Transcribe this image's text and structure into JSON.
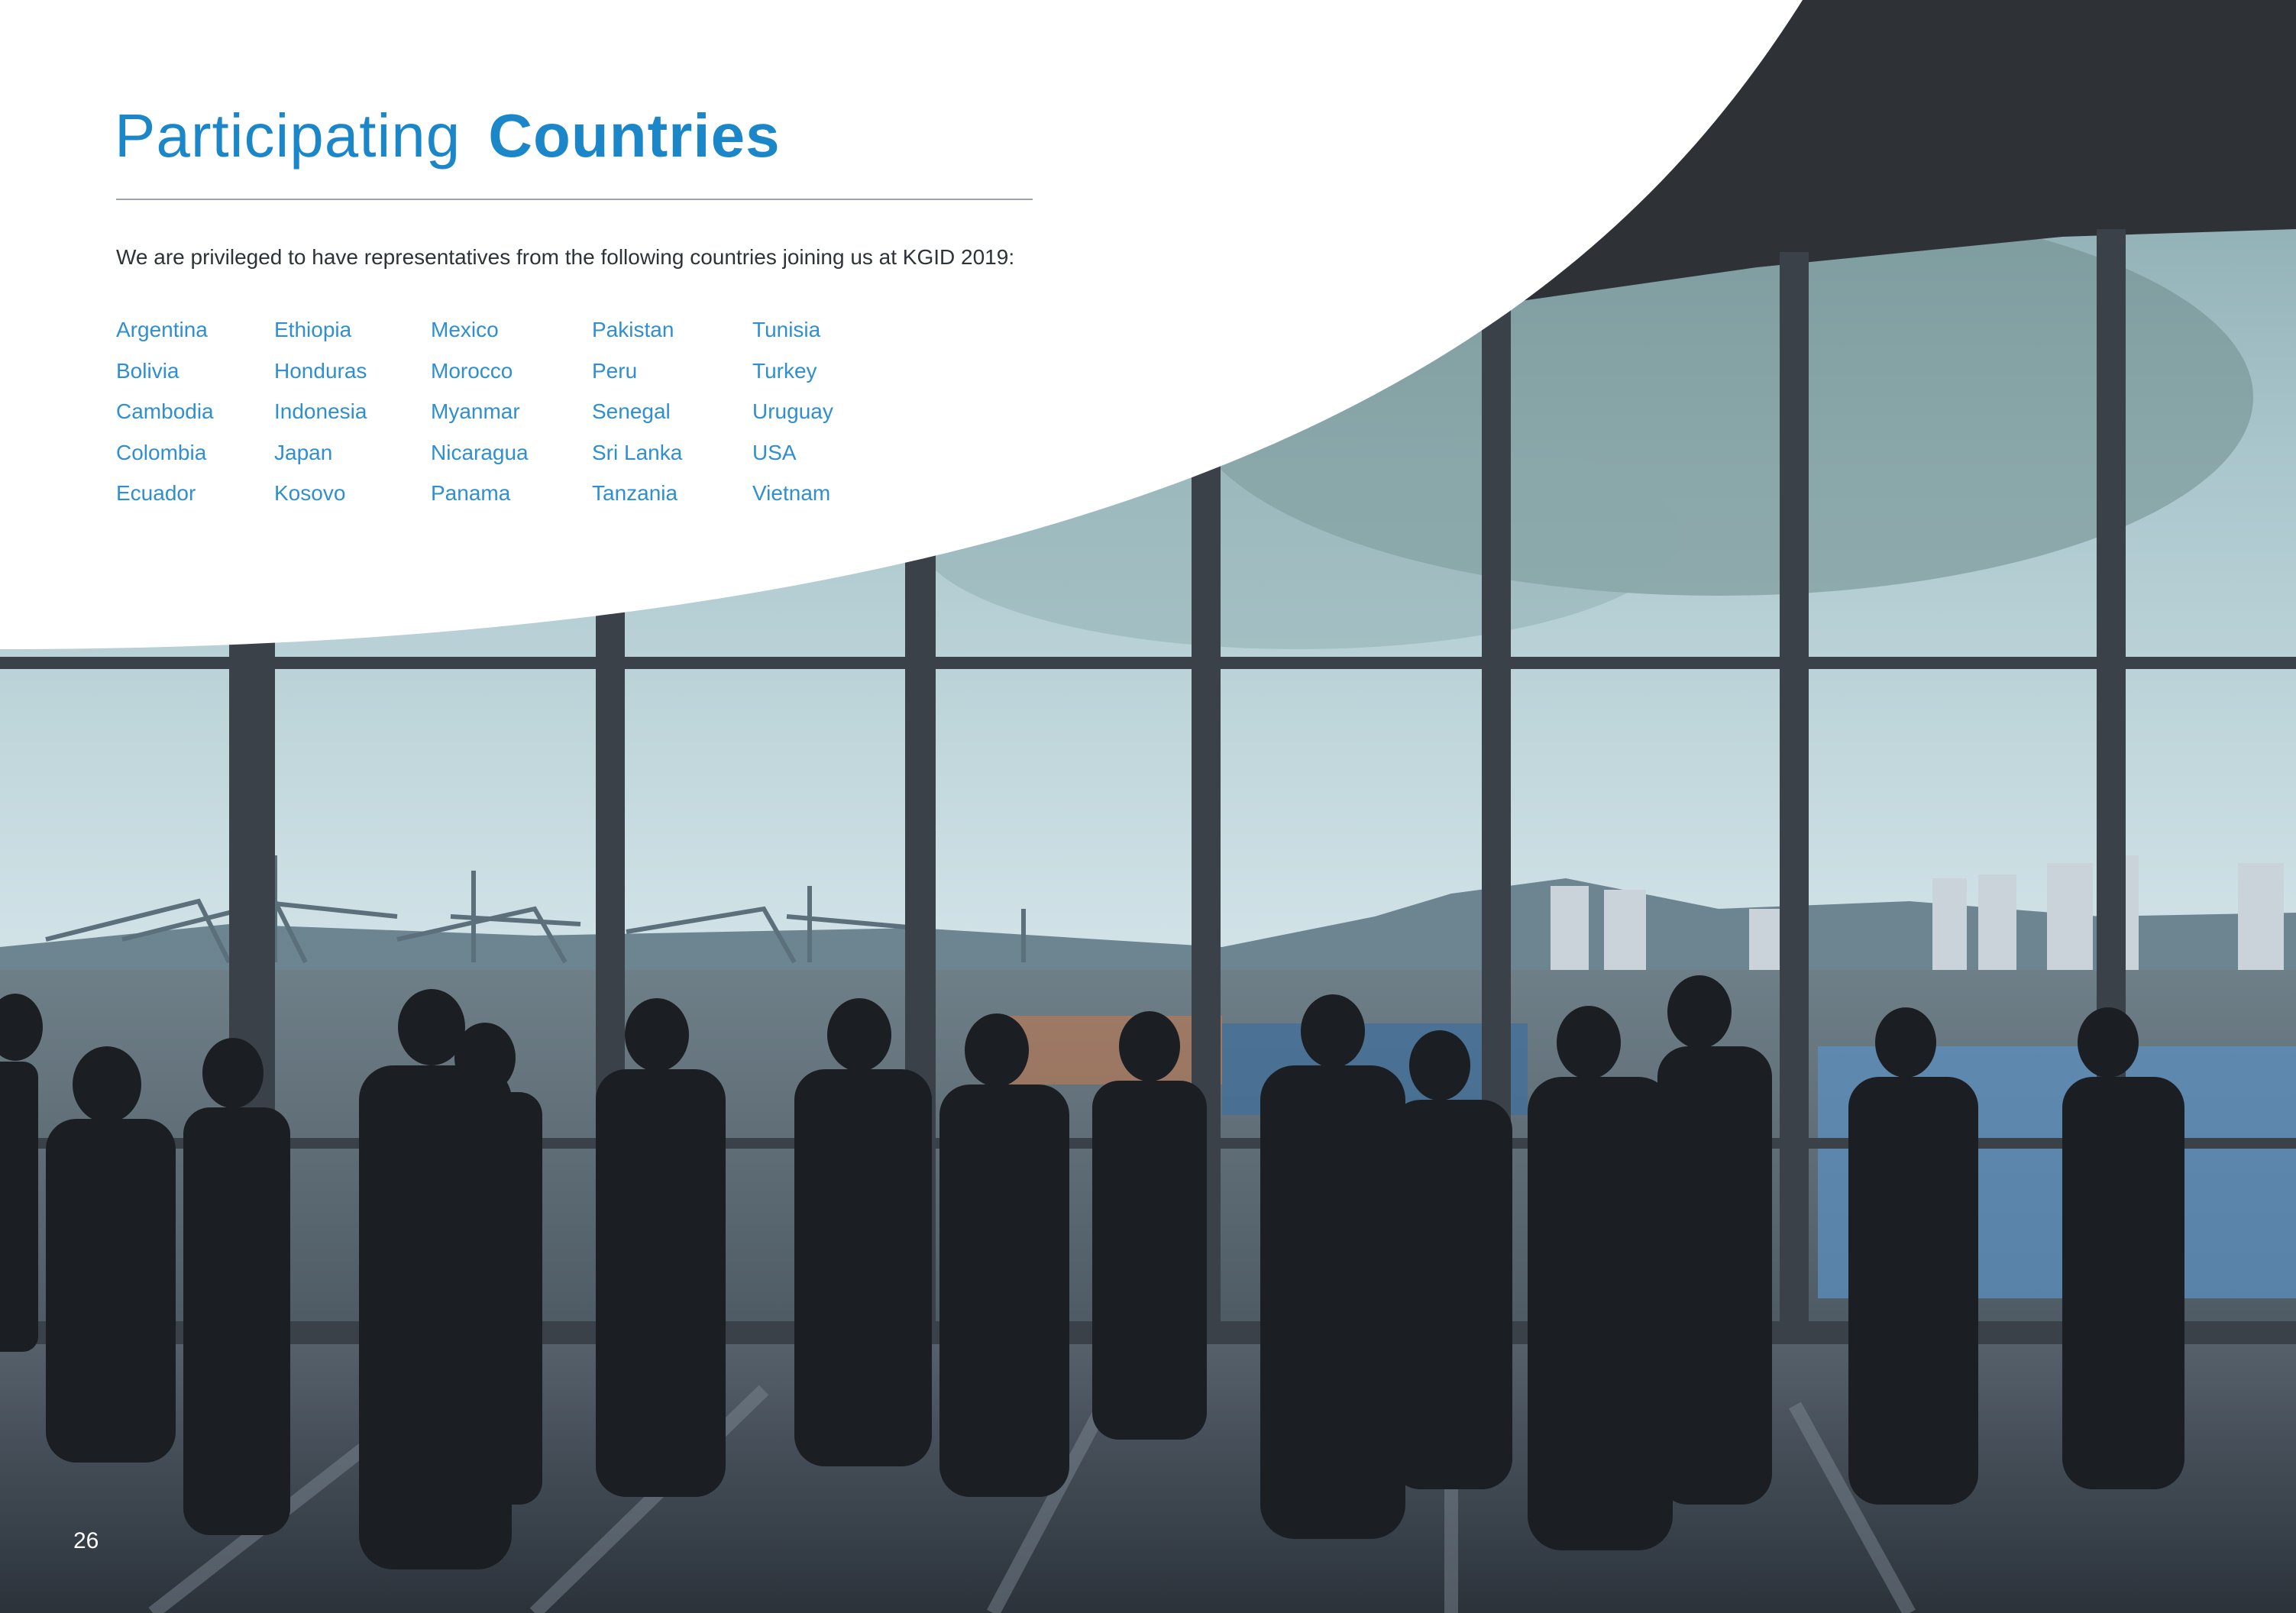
{
  "page": {
    "title_light": "Participating",
    "title_bold": "Countries",
    "intro": "We are privileged to have representatives from the following countries joining us at KGID 2019:",
    "page_number": "26"
  },
  "countries": {
    "col1": [
      "Argentina",
      "Bolivia",
      "Cambodia",
      "Colombia",
      "Ecuador"
    ],
    "col2": [
      "Ethiopia",
      "Honduras",
      "Indonesia",
      "Japan",
      "Kosovo"
    ],
    "col3": [
      "Mexico",
      "Morocco",
      "Myanmar",
      "Nicaragua",
      "Panama"
    ],
    "col4": [
      "Pakistan",
      "Peru",
      "Senegal",
      "Sri Lanka",
      "Tanzania"
    ],
    "col5": [
      "Tunisia",
      "Turkey",
      "Uruguay",
      "USA",
      "Vietnam"
    ]
  },
  "colors": {
    "brand_blue": "#1b87c9",
    "country_blue": "#2f8fd0",
    "rule_gray": "#9aa3ab"
  },
  "photo": {
    "subject": "group of people silhouetted looking out large curved windows over a container port and city"
  }
}
